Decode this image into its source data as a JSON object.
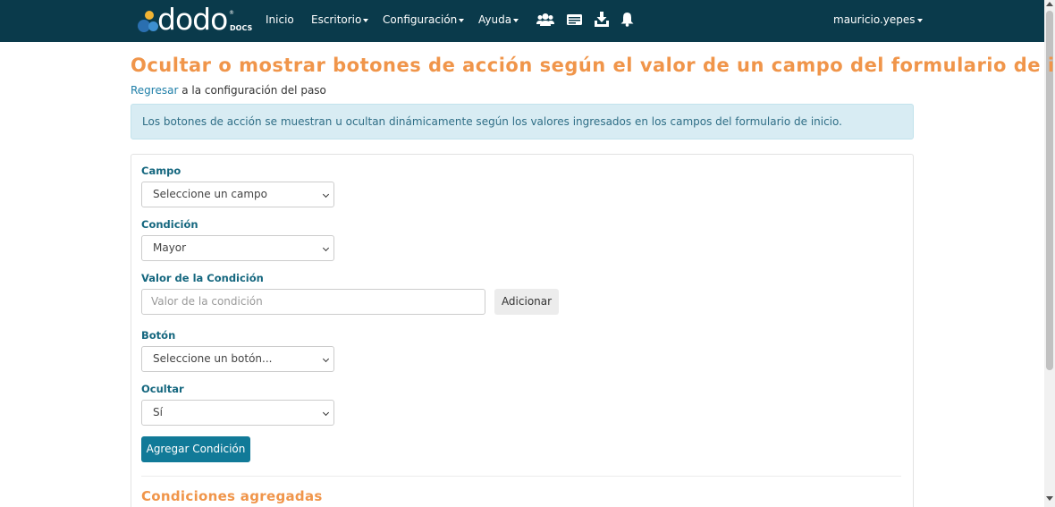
{
  "navbar": {
    "logo_text": "dodo",
    "logo_tm": "®",
    "logo_sub": "DOCS",
    "items": [
      {
        "label": "Inicio",
        "dropdown": false
      },
      {
        "label": "Escritorio",
        "dropdown": true
      },
      {
        "label": "Configuración",
        "dropdown": true
      },
      {
        "label": "Ayuda",
        "dropdown": true
      }
    ],
    "icons": [
      "users-icon",
      "id-card-icon",
      "download-icon",
      "bell-icon"
    ],
    "user": "mauricio.yepes"
  },
  "page": {
    "title": "Ocultar o mostrar botones de acción según el valor de un campo del formulario de inicio",
    "back_link": "Regresar",
    "back_text": " a la configuración del paso",
    "alert": "Los botones de acción se muestran u ocultan dinámicamente según los valores ingresados en los campos del formulario de inicio."
  },
  "form": {
    "campo_label": "Campo",
    "campo_value": "Seleccione un campo",
    "condicion_label": "Condición",
    "condicion_value": "Mayor",
    "valor_label": "Valor de la Condición",
    "valor_placeholder": "Valor de la condición",
    "add_button": "Adicionar",
    "boton_label": "Botón",
    "boton_value": "Seleccione un botón...",
    "ocultar_label": "Ocultar",
    "ocultar_value": "Sí",
    "submit_button": "Agregar Condición"
  },
  "section": {
    "title": "Condiciones agregadas"
  },
  "colors": {
    "navbar": "#0a3a4b",
    "accent_orange": "#f0954a",
    "label_teal": "#15677f",
    "primary_button": "#117a98",
    "alert_bg": "#d8ecf3"
  }
}
